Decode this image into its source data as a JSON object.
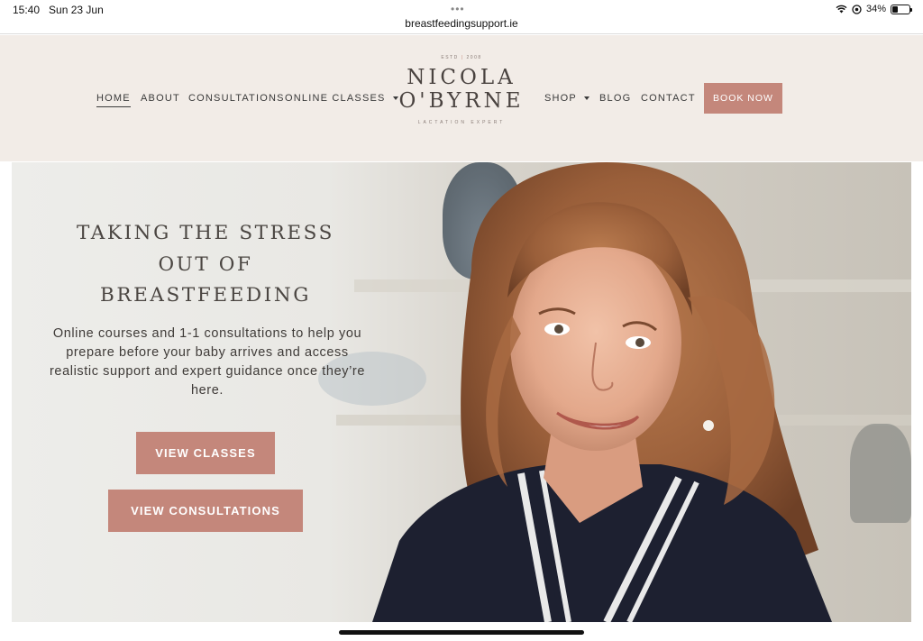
{
  "status_bar": {
    "time": "15:40",
    "date": "Sun 23 Jun",
    "url": "breastfeedingsupport.ie",
    "battery": "34%",
    "icons": [
      "wifi-icon",
      "location-icon",
      "battery-icon"
    ]
  },
  "nav": {
    "left": [
      {
        "label": "HOME",
        "active": true
      },
      {
        "label": "ABOUT"
      },
      {
        "label": "CONSULTATIONS"
      },
      {
        "label": "ONLINE CLASSES",
        "dropdown": true
      }
    ],
    "right": [
      {
        "label": "SHOP",
        "dropdown": true
      },
      {
        "label": "BLOG"
      },
      {
        "label": "CONTACT"
      }
    ],
    "cta": "BOOK NOW"
  },
  "logo": {
    "estd": "ESTD",
    "year": "2008",
    "line1": "NICOLA",
    "line2": "O'BYRNE",
    "tagline": "LACTATION EXPERT"
  },
  "hero": {
    "title_line1": "TAKING THE STRESS",
    "title_line2": "OUT OF",
    "title_line3": "BREASTFEEDING",
    "subtitle": "Online courses and 1-1 consultations to help you prepare before your baby arrives and access realistic support and expert guidance once they’re here.",
    "btn_classes": "VIEW CLASSES",
    "btn_consultations": "VIEW CONSULTATIONS"
  },
  "colors": {
    "accent": "#c4877b",
    "header_bg": "#f2ece7",
    "text": "#3a3a3a"
  }
}
